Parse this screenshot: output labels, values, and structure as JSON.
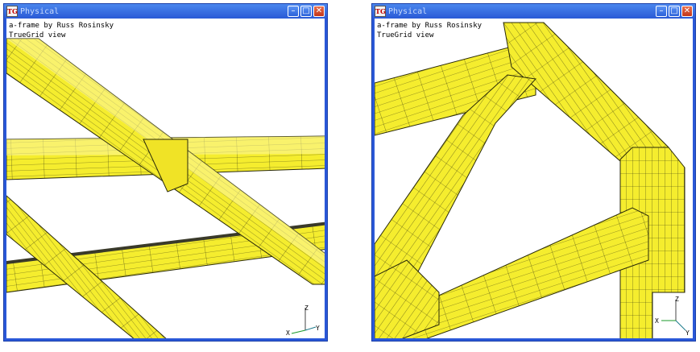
{
  "colors": {
    "beam_fill": "#f5ed2e",
    "beam_light": "#fbf6a0",
    "mesh_line": "#3b3a10",
    "titlebar": "#2a5ad6",
    "axis_x": "#1a9a2a",
    "axis_y": "#1a7a8a"
  },
  "windows": [
    {
      "title": "Physical",
      "icon_label": "TG",
      "caption_line1": "a-frame by Russ Rosinsky",
      "caption_line2": "TrueGrid view",
      "axes": {
        "x": "X",
        "y": "Y",
        "z": "Z"
      }
    },
    {
      "title": "Physical",
      "icon_label": "TG",
      "caption_line1": "a-frame by Russ Rosinsky",
      "caption_line2": "TrueGrid view",
      "axes": {
        "x": "X",
        "y": "Y",
        "z": "Z"
      }
    }
  ]
}
